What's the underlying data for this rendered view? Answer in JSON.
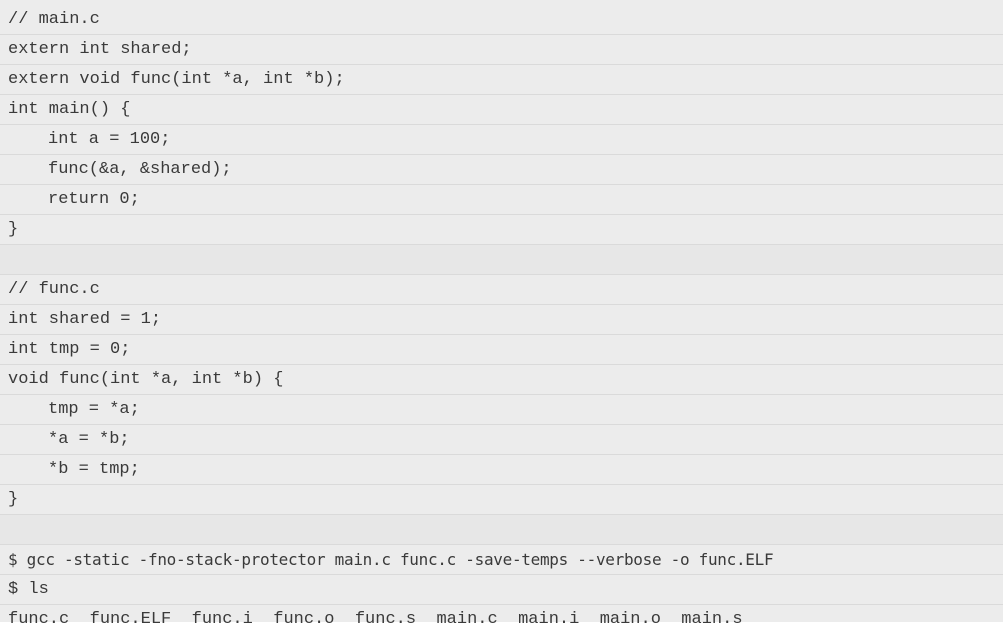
{
  "code": {
    "main_c": {
      "comment": "// main.c",
      "line1": "extern int shared;",
      "line2": "extern void func(int *a, int *b);",
      "line3": "int main() {",
      "line4": "int a = 100;",
      "line5": "func(&a, &shared);",
      "line6": "return 0;",
      "line7": "}"
    },
    "func_c": {
      "comment": "// func.c",
      "line1": "int shared = 1;",
      "line2": "int tmp = 0;",
      "line3": "void func(int *a, int *b) {",
      "line4": "tmp = *a;",
      "line5": "*a = *b;",
      "line6": "*b = tmp;",
      "line7": "}"
    },
    "terminal": {
      "command1": "$ gcc -static -fno-stack-protector main.c func.c -save-temps --verbose -o func.ELF",
      "command2": "$ ls",
      "output": "func.c  func.ELF  func.i  func.o  func.s  main.c  main.i  main.o  main.s"
    }
  }
}
